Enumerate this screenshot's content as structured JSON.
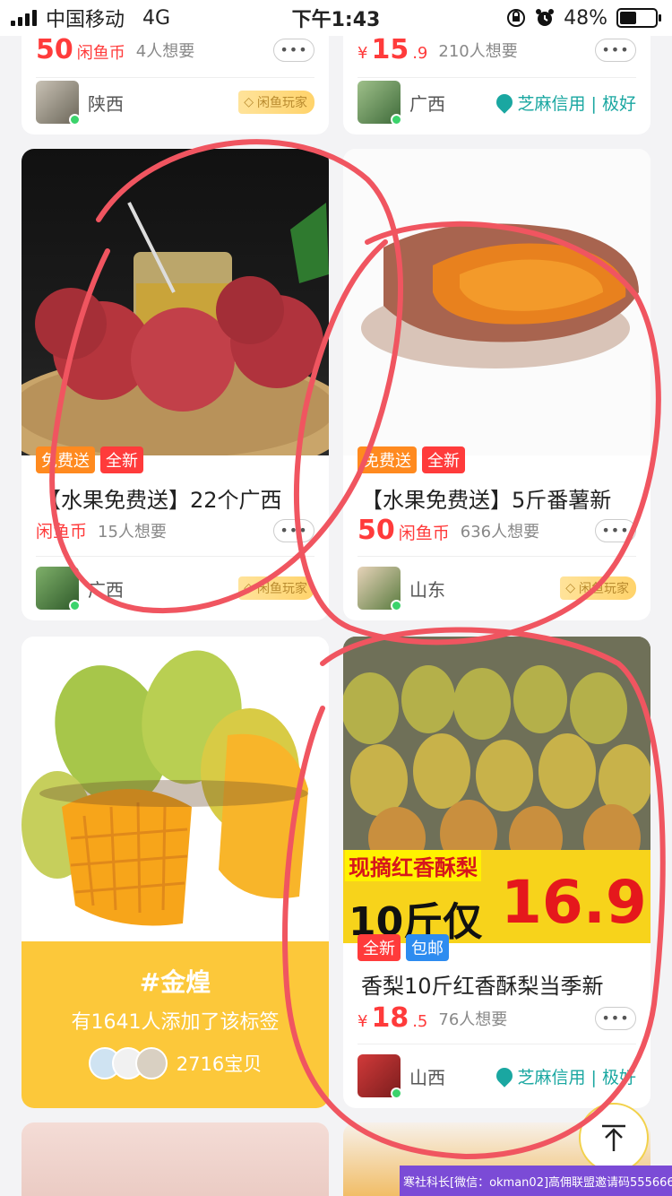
{
  "status_bar": {
    "carrier": "中国移动",
    "network": "4G",
    "time": "下午1:43",
    "battery": "48%",
    "battery_level": 0.48
  },
  "cards": {
    "top_left": {
      "price_big": "50",
      "price_unit": "闲鱼币",
      "want": "4人想要",
      "location": "陕西",
      "badge": "闲鱼玩家"
    },
    "top_right": {
      "price_symbol": "¥",
      "price_int": "15",
      "price_dec": ".9",
      "want": "210人想要",
      "location": "广西",
      "credit": "芝麻信用 | 极好"
    },
    "passion": {
      "tags": [
        "免费送",
        "全新"
      ],
      "title": "【水果免费送】22个广西",
      "price_unit": "闲鱼币",
      "want": "15人想要",
      "location": "广西",
      "badge": "闲鱼玩家"
    },
    "potato": {
      "tags": [
        "免费送",
        "全新"
      ],
      "title": "【水果免费送】5斤番薯新",
      "price_big": "50",
      "price_unit": "闲鱼币",
      "want": "636人想要",
      "location": "山东",
      "badge": "闲鱼玩家"
    },
    "topic": {
      "title": "#金煌",
      "subtitle": "有1641人添加了该标签",
      "count": "2716宝贝"
    },
    "pear": {
      "banner_text": "现摘红香酥梨",
      "banner_price_label": "10斤仅",
      "banner_price": "16.9",
      "tags": [
        "全新",
        "包邮"
      ],
      "title": "香梨10斤红香酥梨当季新",
      "price_symbol": "¥",
      "price_int": "18",
      "price_dec": ".5",
      "want": "76人想要",
      "location": "山西",
      "credit": "芝麻信用 | 极好"
    }
  },
  "more_label": "•••",
  "watermark": "寒社科长[微信：okman02]高佣联盟邀请码555666",
  "colors": {
    "accent_red": "#ff3b3b",
    "topic_yellow": "#fcc83a",
    "credit_teal": "#1aa7a1",
    "annotation": "#f05560"
  }
}
